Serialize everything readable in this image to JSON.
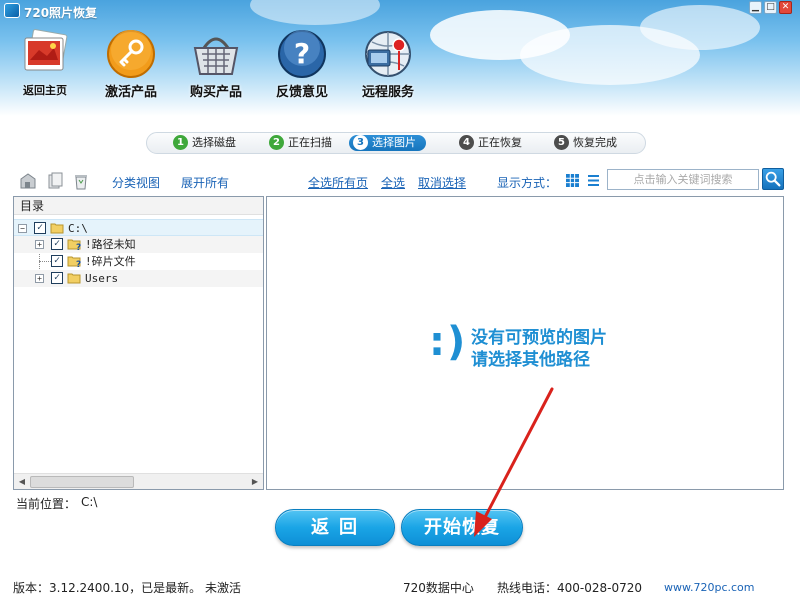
{
  "window": {
    "title": "720照片恢复",
    "buttons": [
      "▁",
      "□",
      "✕"
    ]
  },
  "nav": {
    "home": "返回主页",
    "activate": "激活产品",
    "buy": "购买产品",
    "feedback": "反馈意见",
    "remote": "远程服务"
  },
  "steps": [
    {
      "num": "1",
      "label": "选择磁盘",
      "state": "done"
    },
    {
      "num": "2",
      "label": "正在扫描",
      "state": "done"
    },
    {
      "num": "3",
      "label": "选择图片",
      "state": "active"
    },
    {
      "num": "4",
      "label": "正在恢复",
      "state": "todo"
    },
    {
      "num": "5",
      "label": "恢复完成",
      "state": "todo"
    }
  ],
  "toolbar": {
    "category_view": "分类视图",
    "expand_all": "展开所有",
    "select_all_pages": "全选所有页",
    "select_all": "全选",
    "deselect": "取消选择",
    "display_mode": "显示方式：",
    "search_placeholder": "点击输入关键词搜索"
  },
  "tree": {
    "header": "目录",
    "root": "C:\\",
    "items": [
      "!路径未知",
      "!碎片文件",
      "Users"
    ],
    "expanders": {
      "root": "−",
      "child": "+"
    },
    "check": "✓"
  },
  "preview": {
    "emoticon": ":)",
    "line1": "没有可预览的图片",
    "line2": "请选择其他路径"
  },
  "location": {
    "label": "当前位置：",
    "value": "C:\\"
  },
  "buttons": {
    "back": "返回",
    "start": "开始恢复"
  },
  "status": {
    "version": "版本：3.12.2400.10，已是最新。",
    "activation": "未激活",
    "data_center": "720数据中心",
    "hotline": "热线电话：400-028-0720",
    "website": "www.720pc.com"
  },
  "colors": {
    "accent": "#1f8fd3",
    "link": "#1a63b6",
    "step_done": "#3fa83b",
    "step_active": "#1675bd"
  },
  "icons": [
    "home-photo-icon",
    "key-icon",
    "shopping-basket-icon",
    "help-question-icon",
    "remote-service-icon",
    "search-icon",
    "grid-view-icon",
    "list-view-icon",
    "folder-icon"
  ]
}
